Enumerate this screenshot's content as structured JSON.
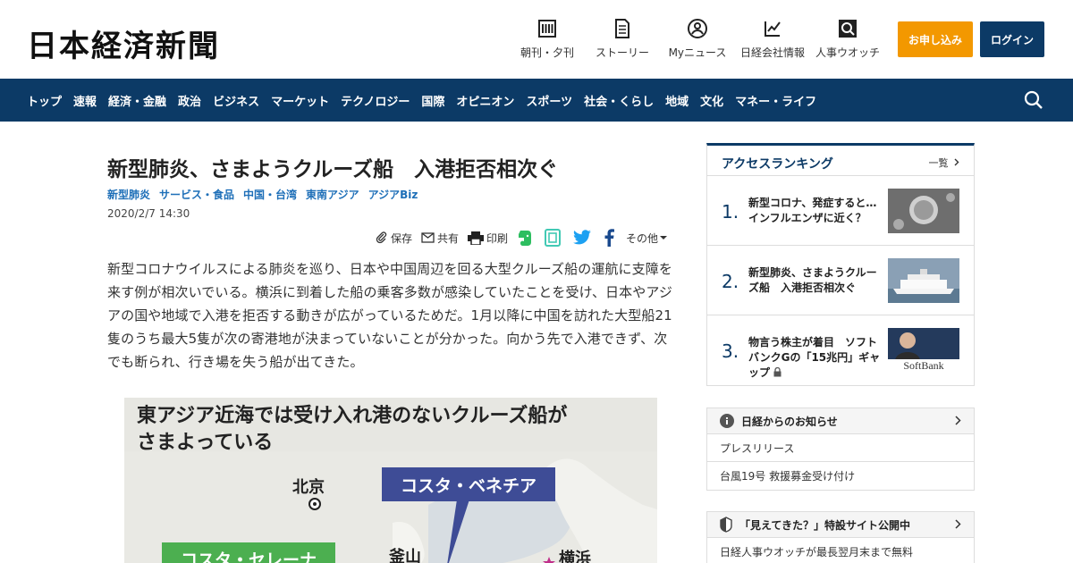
{
  "header": {
    "logo": "日本経済新聞",
    "nav": [
      {
        "label": "朝刊・夕刊",
        "icon": "newspaper-icon"
      },
      {
        "label": "ストーリー",
        "icon": "document-icon"
      },
      {
        "label": "Myニュース",
        "icon": "user-icon"
      },
      {
        "label": "日経会社情報",
        "icon": "chart-icon"
      },
      {
        "label": "人事ウオッチ",
        "icon": "person-search-icon"
      }
    ],
    "subscribe": "お申し込み",
    "login": "ログイン"
  },
  "main_nav": [
    "トップ",
    "速報",
    "経済・金融",
    "政治",
    "ビジネス",
    "マーケット",
    "テクノロジー",
    "国際",
    "オピニオン",
    "スポーツ",
    "社会・くらし",
    "地域",
    "文化",
    "マネー・ライフ"
  ],
  "article": {
    "title": "新型肺炎、さまようクルーズ船　入港拒否相次ぐ",
    "tags": [
      "新型肺炎",
      "サービス・食品",
      "中国・台湾",
      "東南アジア",
      "アジアBiz"
    ],
    "date": "2020/2/7 14:30",
    "share": {
      "save": "保存",
      "share": "共有",
      "print": "印刷",
      "other": "その他"
    },
    "body": "新型コロナウイルスによる肺炎を巡り、日本や中国周辺を回る大型クルーズ船の運航に支障を来す例が相次いでいる。横浜に到着した船の乗客多数が感染していたことを受け、日本やアジアの国や地域で入港を拒否する動きが広がっているためだ。1月以降に中国を訪れた大型船21隻のうち最大5隻が次の寄港地が決まっていないことが分かった。向かう先で入港できず、次でも断られ、行き場を失う船が出てきた。",
    "map": {
      "title_line1": "東アジア近海では受け入れ港のないクルーズ船が",
      "title_line2": "さまよっている",
      "callout_blue": "コスタ・ベネチア",
      "callout_green": "コスタ・セレーナ",
      "city_beijing": "北京",
      "city_busan": "釜山",
      "city_yokohama": "横浜"
    }
  },
  "ranking": {
    "title": "アクセスランキング",
    "more": "一覧",
    "items": [
      {
        "num": "1.",
        "text": "新型コロナ、発症すると…インフルエンザに近く？"
      },
      {
        "num": "2.",
        "text": "新型肺炎、さまようクルーズ船　入港拒否相次ぐ"
      },
      {
        "num": "3.",
        "text": "物言う株主が着目　ソフトバンクGの「15兆円」ギャップ",
        "thumb_text": "SoftBank"
      }
    ]
  },
  "notice1": {
    "title": "日経からのお知らせ",
    "rows": [
      "プレスリリース",
      "台風19号 救援募金受け付け"
    ]
  },
  "notice2": {
    "title": "「見えてきた？」特設サイト公開中",
    "rows": [
      "日経人事ウオッチが最長翌月末まで無料"
    ]
  }
}
